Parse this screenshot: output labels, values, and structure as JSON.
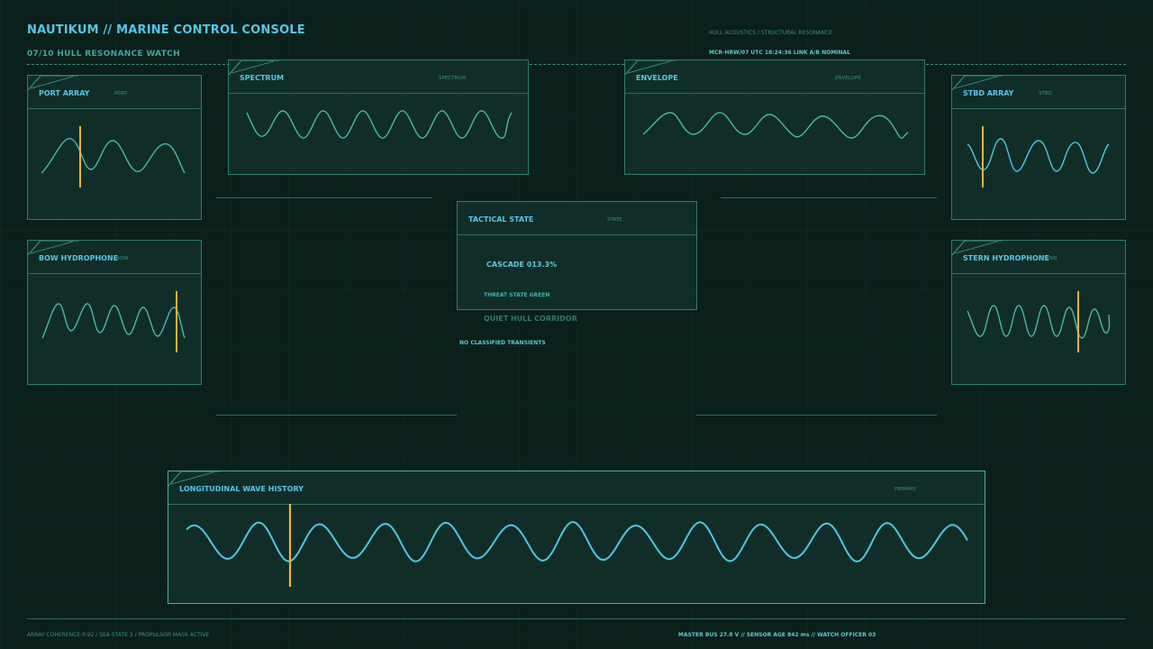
{
  "header": {
    "title": "NAUTIKUM // MARINE CONTROL CONSOLE",
    "subtitle": "07/10  HULL RESONANCE WATCH",
    "right_line_1": "HULL ACOUSTICS / STRUCTURAL RESONANCE",
    "right_line_2": "MCR-HRW/07  UTC 18:24:36  LINK A/B NOMINAL"
  },
  "panels": {
    "port_array": {
      "title": "PORT ARRAY",
      "tag": "PORT"
    },
    "spectrum": {
      "title": "SPECTRUM",
      "tag": "SPECTRUM"
    },
    "envelope": {
      "title": "ENVELOPE",
      "tag": "ENVELOPE"
    },
    "stbd_array": {
      "title": "STBD ARRAY",
      "tag": "STBD"
    },
    "bow_hydrophone": {
      "title": "BOW HYDROPHONE",
      "tag": "BOW"
    },
    "stern_hydrophone": {
      "title": "STERN HYDROPHONE",
      "tag": "STERN"
    },
    "tactical": {
      "title": "TACTICAL STATE",
      "tag": "STATE",
      "cascade": "CASCADE 013.3%",
      "threat": "THREAT STATE GREEN"
    },
    "history": {
      "title": "LONGITUDINAL WAVE HISTORY",
      "tag": "PRIMARY"
    }
  },
  "status": {
    "corridor": "QUIET HULL CORRIDOR",
    "transients": "NO CLASSIFIED TRANSIENTS"
  },
  "footer": {
    "left": "ARRAY COHERENCE 0.92 / SEA STATE 3 / PROPULSOR MASK ACTIVE",
    "right": "MASTER BUS 27.8 V  //  SENSOR AGE 842 ms  //  WATCH OFFICER 03"
  },
  "colors": {
    "accent": "#56c6e8",
    "trace": "#49b7b0",
    "trace_primary": "#4fc6e6",
    "marker": "#f2b233",
    "frame": "#2f7d6c"
  }
}
